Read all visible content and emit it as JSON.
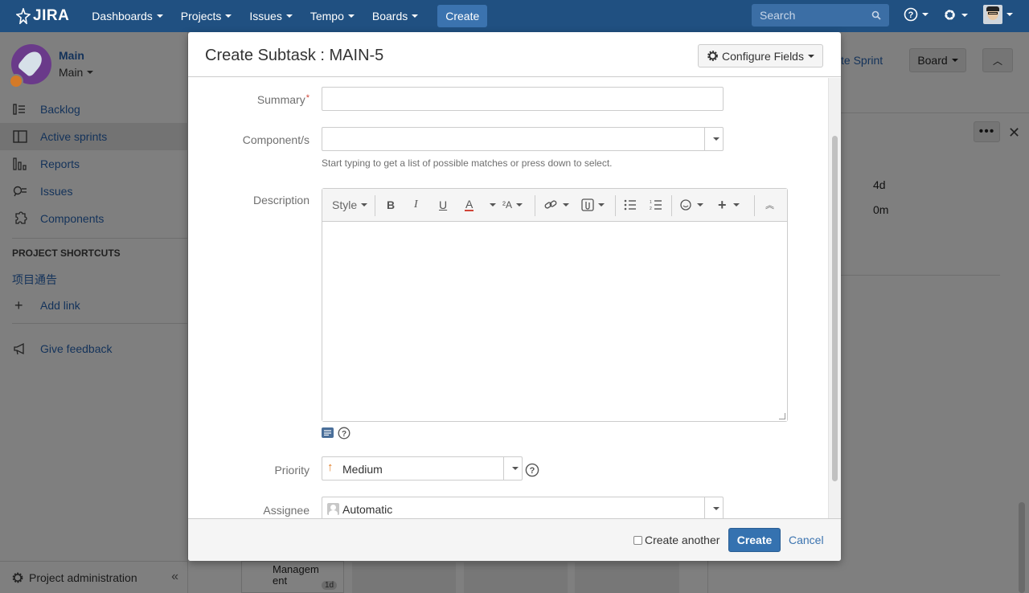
{
  "topnav": {
    "logo": "JIRA",
    "links": [
      "Dashboards",
      "Projects",
      "Issues",
      "Tempo",
      "Boards"
    ],
    "create": "Create",
    "search_placeholder": "Search"
  },
  "sidebar": {
    "project_title": "Main",
    "project_sub": "Main",
    "items": [
      {
        "label": "Backlog",
        "icon": "backlog-icon"
      },
      {
        "label": "Active sprints",
        "icon": "board-icon"
      },
      {
        "label": "Reports",
        "icon": "reports-icon"
      },
      {
        "label": "Issues",
        "icon": "issues-icon"
      },
      {
        "label": "Components",
        "icon": "components-icon"
      }
    ],
    "shortcuts_heading": "PROJECT SHORTCUTS",
    "shortcut_link": "项目通告",
    "add_link": "Add link",
    "feedback": "Give feedback",
    "admin": "Project administration"
  },
  "background": {
    "sprint_link": "te Sprint",
    "board_btn": "Board",
    "estimate_1": "4d",
    "estimate_2": "0m",
    "card_text_1": "Managem",
    "card_text_2": "ent",
    "card_badge": "1d"
  },
  "dialog": {
    "title": "Create Subtask : MAIN-5",
    "configure_fields": "Configure Fields",
    "summary_label": "Summary",
    "summary_value": "",
    "components_label": "Component/s",
    "components_hint": "Start typing to get a list of possible matches or press down to select.",
    "description_label": "Description",
    "toolbar_style": "Style",
    "priority_label": "Priority",
    "priority_value": "Medium",
    "assignee_label": "Assignee",
    "assignee_value": "Automatic",
    "create_another": "Create another",
    "create_btn": "Create",
    "cancel": "Cancel"
  },
  "colors": {
    "nav": "#205081",
    "primary_button": "#3572b0",
    "link": "#3b73af",
    "required": "#d04437",
    "priority_medium": "#e07b22"
  }
}
